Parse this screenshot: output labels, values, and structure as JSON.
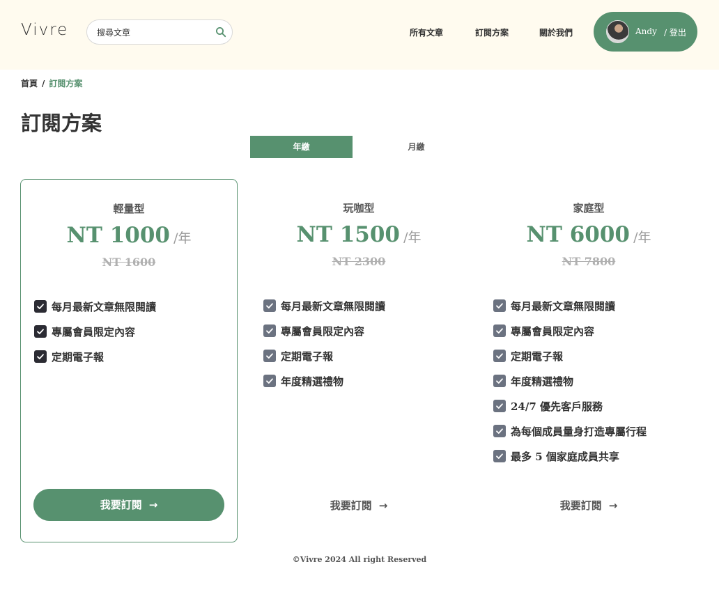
{
  "header": {
    "logo": "Vivre",
    "search_placeholder": "搜尋文章",
    "nav": [
      "所有文章",
      "訂閱方案",
      "關於我們"
    ],
    "user_name": "Andy",
    "logout": "/ 登出"
  },
  "breadcrumb": {
    "home": "首頁",
    "separator": "/",
    "current": "訂閱方案"
  },
  "page_title": "訂閱方案",
  "billing_toggle": {
    "yearly": "年繳",
    "monthly": "月繳",
    "selected": "年繳"
  },
  "plans": [
    {
      "name": "輕量型",
      "price": "NT 1000",
      "unit": "/年",
      "original_price": "NT 1600",
      "features": [
        "每月最新文章無限閱讀",
        "專屬會員限定內容",
        "定期電子報"
      ],
      "cta": "我要訂閱"
    },
    {
      "name": "玩咖型",
      "price": "NT 1500",
      "unit": "/年",
      "original_price": "NT 2300",
      "features": [
        "每月最新文章無限閱讀",
        "專屬會員限定內容",
        "定期電子報",
        "年度精選禮物"
      ],
      "cta": "我要訂閱"
    },
    {
      "name": "家庭型",
      "price": "NT 6000",
      "unit": "/年",
      "original_price": "NT 7800",
      "features": [
        "每月最新文章無限閱讀",
        "專屬會員限定內容",
        "定期電子報",
        "年度精選禮物",
        "24/7 優先客戶服務",
        "為每個成員量身打造專屬行程",
        "最多 5 個家庭成員共享"
      ],
      "cta": "我要訂閱"
    }
  ],
  "footer": "©Vivre 2024 All right Reserved",
  "colors": {
    "primary": "#57916f",
    "header_bg": "#fffbef",
    "check_dark": "#2b2b33",
    "check_gray": "#6b7280"
  }
}
